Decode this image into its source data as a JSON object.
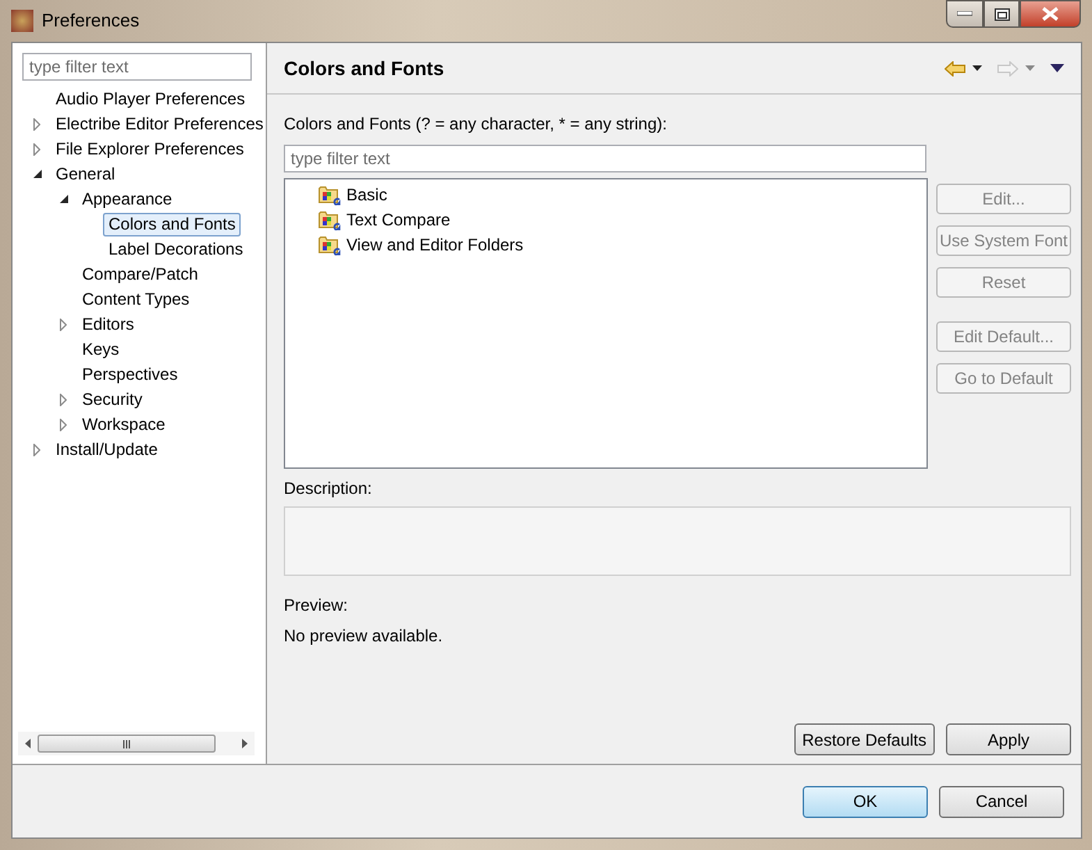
{
  "window": {
    "title": "Preferences"
  },
  "filter": {
    "placeholder": "type filter text"
  },
  "tree": [
    {
      "label": "Audio Player Preferences",
      "selected": false
    },
    {
      "label": "Electribe Editor Preferences",
      "selected": false,
      "expanded": false
    },
    {
      "label": "File Explorer Preferences",
      "selected": false,
      "expanded": false
    },
    {
      "label": "General",
      "selected": false,
      "expanded": true,
      "children": [
        {
          "label": "Appearance",
          "selected": false,
          "expanded": true,
          "children": [
            {
              "label": "Colors and Fonts",
              "selected": true
            },
            {
              "label": "Label Decorations",
              "selected": false
            }
          ]
        },
        {
          "label": "Compare/Patch",
          "selected": false
        },
        {
          "label": "Content Types",
          "selected": false
        },
        {
          "label": "Editors",
          "selected": false,
          "expanded": false
        },
        {
          "label": "Keys",
          "selected": false
        },
        {
          "label": "Perspectives",
          "selected": false
        },
        {
          "label": "Security",
          "selected": false,
          "expanded": false
        },
        {
          "label": "Workspace",
          "selected": false,
          "expanded": false
        }
      ]
    },
    {
      "label": "Install/Update",
      "selected": false,
      "expanded": false
    }
  ],
  "page": {
    "title": "Colors and Fonts",
    "filter_label": "Colors and Fonts (? = any character, * = any string):",
    "filter_placeholder": "type filter text",
    "categories": [
      "Basic",
      "Text Compare",
      "View and Editor Folders"
    ],
    "side_buttons": [
      {
        "label": "Edit...",
        "disabled": true
      },
      {
        "label": "Use System Font",
        "disabled": true
      },
      {
        "label": "Reset",
        "disabled": true
      },
      {
        "label": "Edit Default...",
        "disabled": true
      },
      {
        "label": "Go to Default",
        "disabled": true
      }
    ],
    "description_label": "Description:",
    "preview_label": "Preview:",
    "preview_text": "No preview available.",
    "buttons": [
      "Restore Defaults",
      "Apply"
    ]
  },
  "dialog_buttons": [
    {
      "label": "OK",
      "default": true
    },
    {
      "label": "Cancel",
      "default": false
    }
  ]
}
